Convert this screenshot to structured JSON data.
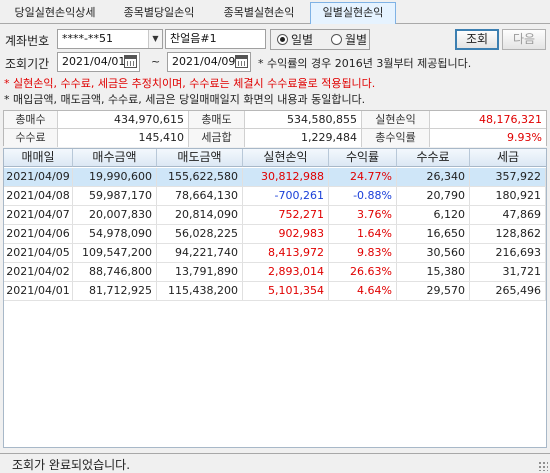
{
  "tabs": [
    {
      "label": "당일실현손익상세"
    },
    {
      "label": "종목별당일손익"
    },
    {
      "label": "종목별실현손익"
    },
    {
      "label": "일별실현손익"
    }
  ],
  "active_tab": 3,
  "form": {
    "account_label": "계좌번호",
    "account_value": "****-**51",
    "account_name": "찬얼음#1",
    "radio_daily": "일별",
    "radio_monthly": "월별",
    "radio_selected": "daily",
    "query_button": "조회",
    "next_button": "다음",
    "period_label": "조회기간",
    "date_from": "2021/04/01",
    "date_sep": "~",
    "date_to": "2021/04/09",
    "period_note": "* 수익률의 경우 2016년 3월부터 제공됩니다."
  },
  "notes": {
    "red": "* 실현손익, 수수료, 세금은 추정치이며, 수수료는 체결시 수수료율로 적용됩니다.",
    "black": "* 매입금액, 매도금액, 수수료, 세금은 당일매매일지 화면의 내용과 동일합니다."
  },
  "summary": {
    "buy_total_label": "총매수",
    "buy_total": "434,970,615",
    "sell_total_label": "총매도",
    "sell_total": "534,580,855",
    "realized_label": "실현손익",
    "realized": "48,176,321",
    "fee_label": "수수료",
    "fee": "145,410",
    "tax_label": "세금합",
    "tax": "1,229,484",
    "return_label": "총수익률",
    "return": "9.93%"
  },
  "table": {
    "headers": [
      "매매일",
      "매수금액",
      "매도금액",
      "실현손익",
      "수익률",
      "수수료",
      "세금"
    ],
    "rows": [
      {
        "date": "2021/04/09",
        "buy": "19,990,600",
        "sell": "155,622,580",
        "pnl": "30,812,988",
        "ret": "24.77%",
        "fee": "26,340",
        "tax": "357,922",
        "sign": "pos",
        "selected": true
      },
      {
        "date": "2021/04/08",
        "buy": "59,987,170",
        "sell": "78,664,130",
        "pnl": "-700,261",
        "ret": "-0.88%",
        "fee": "20,790",
        "tax": "180,921",
        "sign": "neg",
        "selected": false
      },
      {
        "date": "2021/04/07",
        "buy": "20,007,830",
        "sell": "20,814,090",
        "pnl": "752,271",
        "ret": "3.76%",
        "fee": "6,120",
        "tax": "47,869",
        "sign": "pos",
        "selected": false
      },
      {
        "date": "2021/04/06",
        "buy": "54,978,090",
        "sell": "56,028,225",
        "pnl": "902,983",
        "ret": "1.64%",
        "fee": "16,650",
        "tax": "128,862",
        "sign": "pos",
        "selected": false
      },
      {
        "date": "2021/04/05",
        "buy": "109,547,200",
        "sell": "94,221,740",
        "pnl": "8,413,972",
        "ret": "9.83%",
        "fee": "30,560",
        "tax": "216,693",
        "sign": "pos",
        "selected": false
      },
      {
        "date": "2021/04/02",
        "buy": "88,746,800",
        "sell": "13,791,890",
        "pnl": "2,893,014",
        "ret": "26.63%",
        "fee": "15,380",
        "tax": "31,721",
        "sign": "pos",
        "selected": false
      },
      {
        "date": "2021/04/01",
        "buy": "81,712,925",
        "sell": "115,438,200",
        "pnl": "5,101,354",
        "ret": "4.64%",
        "fee": "29,570",
        "tax": "265,496",
        "sign": "pos",
        "selected": false
      }
    ]
  },
  "status": {
    "text": "조회가 완료되었습니다."
  },
  "colors": {
    "positive": "#e00000",
    "negative": "#1a3fd8",
    "selected_row": "#cfe6f8",
    "active_tab": "#e6f3ff"
  }
}
